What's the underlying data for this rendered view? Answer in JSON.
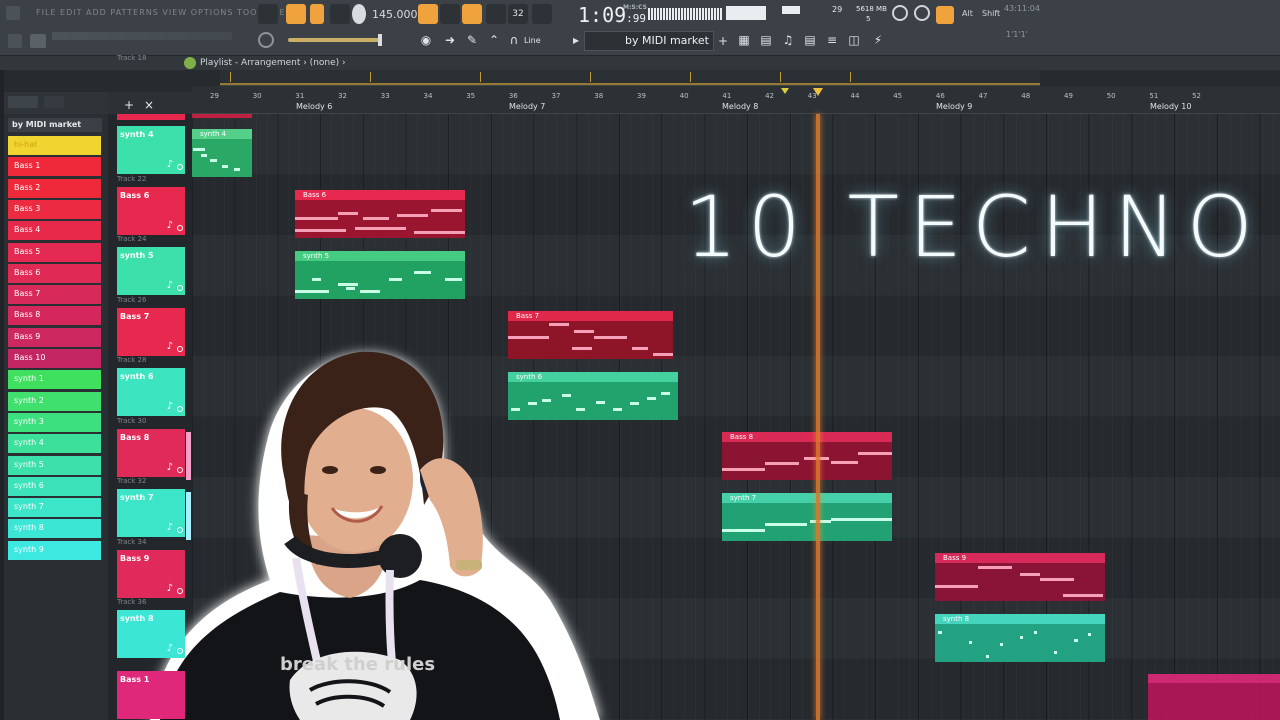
{
  "window": {
    "menu_blur": "FILE EDIT ADD PATTERNS VIEW OPTIONS TOOLS HELP",
    "tempo": "145.000",
    "time": "1:09",
    "time_frac": ":99",
    "time_unit": "M:S:CS",
    "cpu": "29",
    "memory": "5618 MB",
    "memory_sub": "5",
    "alt_label": "Alt",
    "shift_label": "Shift",
    "clock": "43:11:04",
    "clock_sub": "1'1'1'",
    "line_mode": "Line",
    "pattern_name": "by MIDI market",
    "pattern_add": "+"
  },
  "playlist": {
    "breadcrumb": "Playlist - Arrangement › (none) ›",
    "channel_header": "by MIDI market",
    "add_track": "+",
    "close_track": "×"
  },
  "channels": [
    {
      "label": "hi-hat",
      "color": "#f0d430",
      "text": "#d0a010"
    },
    {
      "label": "Bass 1",
      "color": "#f0293a"
    },
    {
      "label": "Bass 2",
      "color": "#f0293a"
    },
    {
      "label": "Bass 3",
      "color": "#ec2a42"
    },
    {
      "label": "Bass 4",
      "color": "#e8294a"
    },
    {
      "label": "Bass 5",
      "color": "#e42a52"
    },
    {
      "label": "Bass 6",
      "color": "#e02a56"
    },
    {
      "label": "Bass 7",
      "color": "#d82a5a"
    },
    {
      "label": "Bass 8",
      "color": "#d4285c"
    },
    {
      "label": "Bass 9",
      "color": "#ce2860"
    },
    {
      "label": "Bass 10",
      "color": "#c42664"
    },
    {
      "label": "synth 1",
      "color": "#3fe05e"
    },
    {
      "label": "synth 2",
      "color": "#3fe06e"
    },
    {
      "label": "synth 3",
      "color": "#3de07e"
    },
    {
      "label": "synth 4",
      "color": "#3ce09a"
    },
    {
      "label": "synth 5",
      "color": "#3ce0aa"
    },
    {
      "label": "synth 6",
      "color": "#3ce2ba"
    },
    {
      "label": "synth 7",
      "color": "#3ce4c8"
    },
    {
      "label": "synth 8",
      "color": "#3ce6d4"
    },
    {
      "label": "synth 9",
      "color": "#3ce8e0"
    }
  ],
  "ruler": {
    "bars": [
      "29",
      "30",
      "31",
      "32",
      "33",
      "34",
      "35",
      "36",
      "37",
      "38",
      "39",
      "40",
      "41",
      "42",
      "43",
      "44",
      "45",
      "46",
      "47",
      "48",
      "49",
      "50",
      "51",
      "52"
    ],
    "markers": [
      "Melody 6",
      "Melody 7",
      "Melody 8",
      "Melody 9",
      "Melody 10"
    ]
  },
  "tracks": [
    {
      "num": "Track 18",
      "name": "",
      "color": "#e8294f"
    },
    {
      "num": "Track 20",
      "name": "synth 4",
      "color": "#3ce0aa"
    },
    {
      "num": "Track 22",
      "name": "Bass 6",
      "color": "#e8294f"
    },
    {
      "num": "Track 24",
      "name": "synth 5",
      "color": "#3ce0aa"
    },
    {
      "num": "Track 26",
      "name": "Bass 7",
      "color": "#e8294f"
    },
    {
      "num": "Track 28",
      "name": "synth 6",
      "color": "#3ce4c0"
    },
    {
      "num": "Track 30",
      "name": "Bass 8",
      "color": "#e02a58"
    },
    {
      "num": "Track 32",
      "name": "synth 7",
      "color": "#3ce4c8"
    },
    {
      "num": "Track 34",
      "name": "Bass 9",
      "color": "#e02a5c"
    },
    {
      "num": "Track 36",
      "name": "synth 8",
      "color": "#3ce6d4"
    },
    {
      "num": "",
      "name": "Bass 1",
      "color": "#e0287a"
    }
  ],
  "clips": [
    {
      "name": "synth 4",
      "color": "#2aa866",
      "head": "#55d08a"
    },
    {
      "name": "Bass 6",
      "color": "#9a1630",
      "head": "#e8294f"
    },
    {
      "name": "synth 5",
      "color": "#22a262",
      "head": "#45cc82"
    },
    {
      "name": "Bass 7",
      "color": "#8e1428",
      "head": "#e0294a"
    },
    {
      "name": "synth 6",
      "color": "#22a26c",
      "head": "#45d0a0"
    },
    {
      "name": "Bass 8",
      "color": "#8a1432",
      "head": "#d82a54"
    },
    {
      "name": "synth 7",
      "color": "#22a274",
      "head": "#45d0aa"
    },
    {
      "name": "Bass 9",
      "color": "#8a1438",
      "head": "#d82a5a"
    },
    {
      "name": "synth 8",
      "color": "#22a282",
      "head": "#45d4be"
    }
  ],
  "overlay": {
    "headline": "10 TECHNO",
    "shirt_text": "break the rules"
  }
}
